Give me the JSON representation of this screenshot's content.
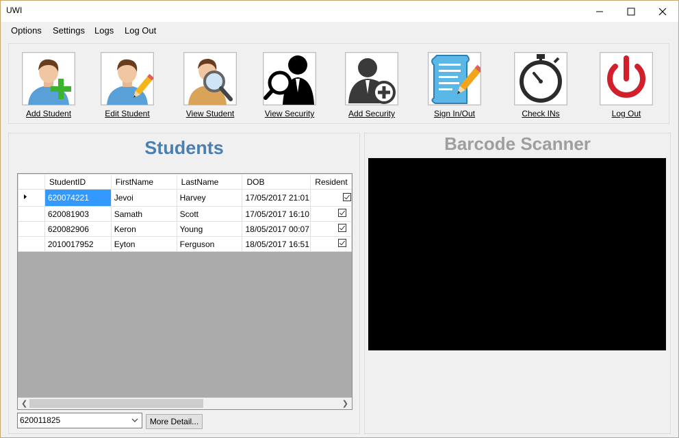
{
  "window": {
    "title": "UWI"
  },
  "menu": [
    "Options",
    "Settings",
    "Logs",
    "Log Out"
  ],
  "toolbar": [
    {
      "label": "Add Student",
      "icon": "add-student-icon"
    },
    {
      "label": "Edit Student",
      "icon": "edit-student-icon"
    },
    {
      "label": "View Student",
      "icon": "view-student-icon"
    },
    {
      "label": "View Security",
      "icon": "view-security-icon"
    },
    {
      "label": "Add Security",
      "icon": "add-security-icon"
    },
    {
      "label": "Sign In/Out",
      "icon": "sign-in-out-icon"
    },
    {
      "label": "Check INs",
      "icon": "stopwatch-icon"
    },
    {
      "label": "Log Out",
      "icon": "power-icon"
    }
  ],
  "students": {
    "title": "Students",
    "columns": [
      "StudentID",
      "FirstName",
      "LastName",
      "DOB",
      "Resident"
    ],
    "rows": [
      {
        "id": "620074221",
        "first": "Jevoi",
        "last": "Harvey",
        "dob": "17/05/2017 21:01",
        "resident": true
      },
      {
        "id": "620081903",
        "first": "Samath",
        "last": "Scott",
        "dob": "17/05/2017 16:10",
        "resident": true
      },
      {
        "id": "620082906",
        "first": "Keron",
        "last": "Young",
        "dob": "18/05/2017 00:07",
        "resident": true
      },
      {
        "id": "2010017952",
        "first": "Eyton",
        "last": "Ferguson",
        "dob": "18/05/2017 16:51",
        "resident": true
      }
    ],
    "selected_id": "620011825",
    "more_button": "More Detail..."
  },
  "scanner": {
    "title": "Barcode Scanner"
  },
  "colors": {
    "students_title": "#4a7fb0",
    "scanner_title": "#9e9e9e",
    "selection": "#3399ff",
    "power": "#d11f2b"
  }
}
